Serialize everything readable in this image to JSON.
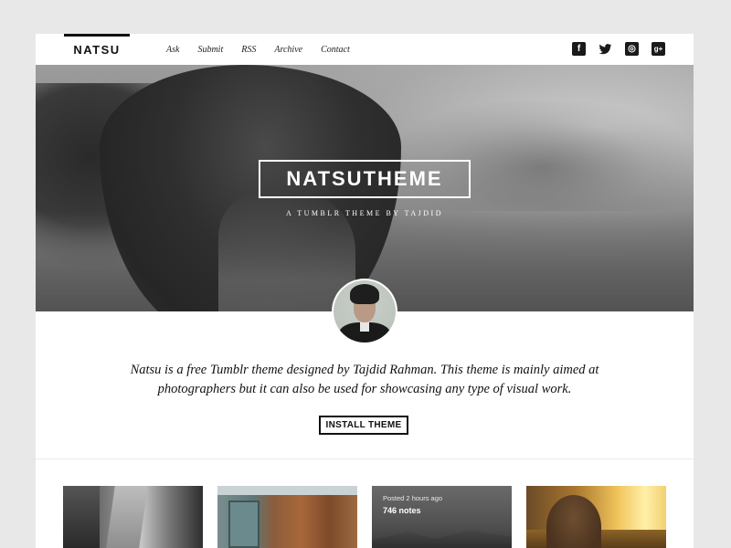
{
  "header": {
    "logo": "NATSU",
    "nav": [
      {
        "label": "Ask"
      },
      {
        "label": "Submit"
      },
      {
        "label": "RSS"
      },
      {
        "label": "Archive"
      },
      {
        "label": "Contact"
      }
    ],
    "social": [
      {
        "icon": "facebook-icon",
        "glyph": "f"
      },
      {
        "icon": "twitter-icon",
        "glyph": "🐦"
      },
      {
        "icon": "instagram-icon",
        "glyph": "◎"
      },
      {
        "icon": "google-plus-icon",
        "glyph": "g+"
      }
    ]
  },
  "hero": {
    "title": "NATSUTHEME",
    "subtitle": "A TUMBLR THEME BY TAJDID"
  },
  "intro": {
    "text": "Natsu is a free Tumblr theme designed by Tajdid Rahman. This theme is mainly aimed at photographers but it can also be used for showcasing any type of visual work.",
    "install_label": "INSTALL THEME"
  },
  "posts": [
    {
      "kind": "photo",
      "subject": "street-photo"
    },
    {
      "kind": "photo",
      "subject": "wooden-house-photo"
    },
    {
      "kind": "photo",
      "subject": "mountain-photo",
      "meta": "Posted 2 hours ago",
      "notes": "746 notes"
    },
    {
      "kind": "photo",
      "subject": "sunset-girl-photo"
    }
  ],
  "colors": {
    "background": "#e8e8e8",
    "page": "#ffffff",
    "text": "#111111",
    "accent": "#111111"
  }
}
